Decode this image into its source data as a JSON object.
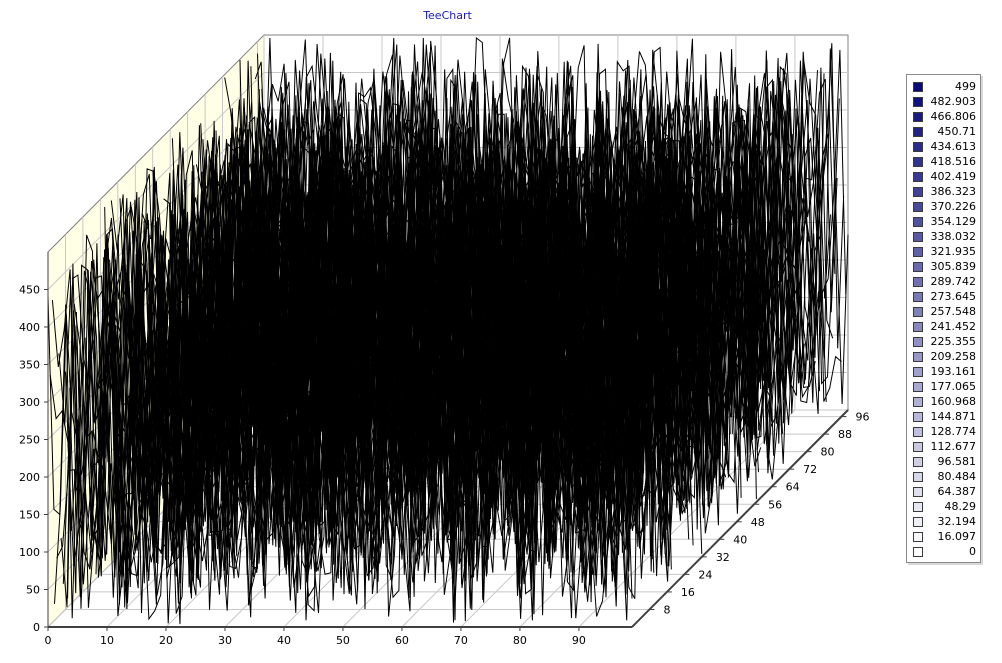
{
  "chart_data": {
    "type": "3d-line",
    "title": "TeeChart",
    "y_ticks": [
      0,
      50,
      100,
      150,
      200,
      250,
      300,
      350,
      400,
      450
    ],
    "x_ticks": [
      0,
      10,
      20,
      30,
      40,
      50,
      60,
      70,
      80,
      90
    ],
    "z_ticks": [
      8,
      16,
      24,
      32,
      40,
      48,
      56,
      64,
      72,
      80,
      88,
      96
    ],
    "ylim": [
      0,
      500
    ],
    "xlim": [
      0,
      99
    ],
    "zlim": [
      0,
      99
    ],
    "grid": true,
    "legend_position": "right",
    "legend": [
      "499",
      "482.903",
      "466.806",
      "450.71",
      "434.613",
      "418.516",
      "402.419",
      "386.323",
      "370.226",
      "354.129",
      "338.032",
      "321.935",
      "305.839",
      "289.742",
      "273.645",
      "257.548",
      "241.452",
      "225.355",
      "209.258",
      "193.161",
      "177.065",
      "160.968",
      "144.871",
      "128.774",
      "112.677",
      "96.581",
      "80.484",
      "64.387",
      "48.29",
      "32.194",
      "16.097",
      "0"
    ],
    "legend_color_high": "#0a0a7a",
    "legend_color_low": "#ffffff",
    "series_count": 100,
    "points_per_series": 100,
    "data_note": "each series is a sequence of values that are uniformly random between 0 and 499",
    "line_color": "#000000",
    "back_wall_color": "#ffffe5"
  }
}
